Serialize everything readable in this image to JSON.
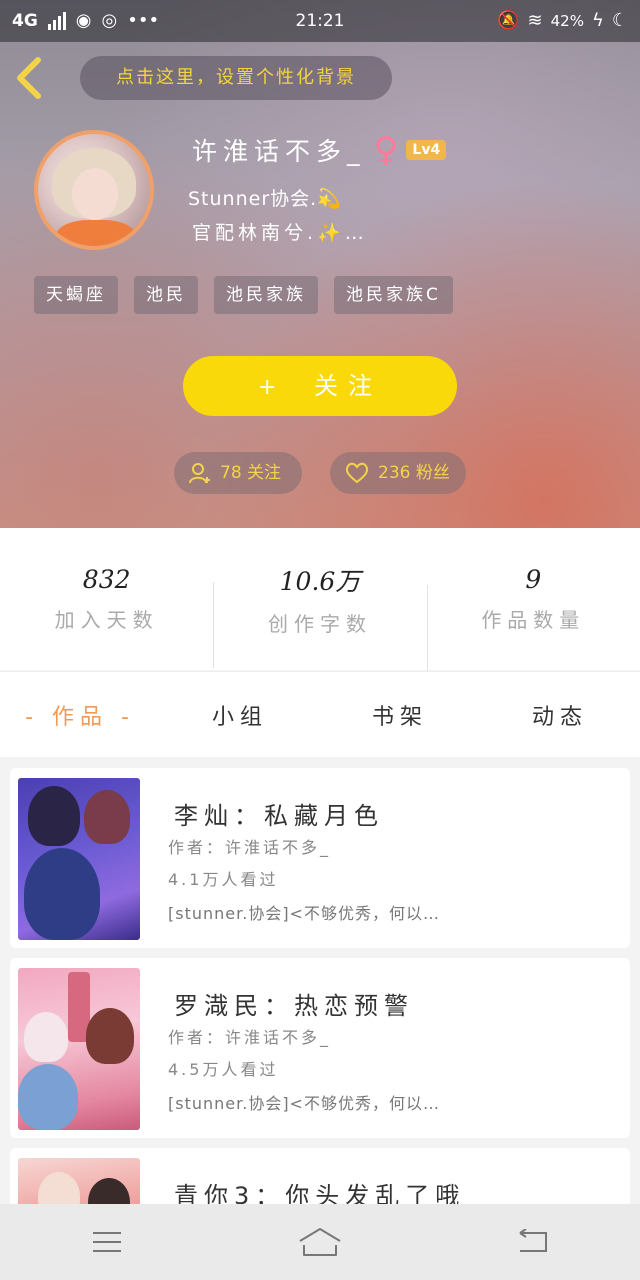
{
  "status_bar": {
    "network": "4G",
    "time": "21:21",
    "battery": "42%"
  },
  "header": {
    "bg_tip": "点击这里，设置个性化背景"
  },
  "profile": {
    "username": "许淮话不多_",
    "level": "Lv4",
    "bio_line1": "Stunner协会.💫",
    "bio_line2": "官配林南兮.✨…",
    "tags": [
      "天蝎座",
      "池民",
      "池民家族",
      "池民家族C"
    ],
    "follow_button": "关注",
    "following_label": "78 关注",
    "fans_label": "236 粉丝"
  },
  "stats": [
    {
      "value": "832",
      "label": "加入天数"
    },
    {
      "value": "10.6万",
      "label": "创作字数"
    },
    {
      "value": "9",
      "label": "作品数量"
    }
  ],
  "tabs": [
    {
      "label": "作品"
    },
    {
      "label": "小组"
    },
    {
      "label": "书架"
    },
    {
      "label": "动态"
    }
  ],
  "tab_active_marker": "- 作品 -",
  "works": [
    {
      "title": "李灿：私藏月色",
      "author": "作者：许淮话不多_",
      "views": "4.1万人看过",
      "desc": "[stunner.协会]<不够优秀，何以…"
    },
    {
      "title": "罗渽民：热恋预警",
      "author": "作者：许淮话不多_",
      "views": "4.5万人看过",
      "desc": "[stunner.协会]<不够优秀，何以…"
    },
    {
      "title": "青你3：你头发乱了哦",
      "author": "",
      "views": "",
      "desc": ""
    }
  ],
  "colors": {
    "accent_yellow": "#f9d90a",
    "active_tab": "#f09a56",
    "badge": "#f2b74a"
  }
}
